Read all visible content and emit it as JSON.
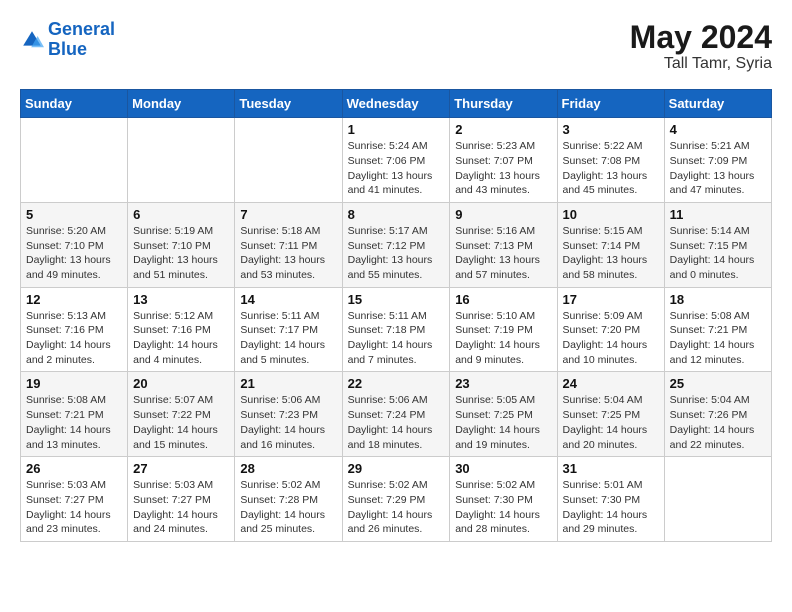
{
  "header": {
    "logo_line1": "General",
    "logo_line2": "Blue",
    "month": "May 2024",
    "location": "Tall Tamr, Syria"
  },
  "weekdays": [
    "Sunday",
    "Monday",
    "Tuesday",
    "Wednesday",
    "Thursday",
    "Friday",
    "Saturday"
  ],
  "weeks": [
    [
      {
        "day": "",
        "info": ""
      },
      {
        "day": "",
        "info": ""
      },
      {
        "day": "",
        "info": ""
      },
      {
        "day": "1",
        "info": "Sunrise: 5:24 AM\nSunset: 7:06 PM\nDaylight: 13 hours\nand 41 minutes."
      },
      {
        "day": "2",
        "info": "Sunrise: 5:23 AM\nSunset: 7:07 PM\nDaylight: 13 hours\nand 43 minutes."
      },
      {
        "day": "3",
        "info": "Sunrise: 5:22 AM\nSunset: 7:08 PM\nDaylight: 13 hours\nand 45 minutes."
      },
      {
        "day": "4",
        "info": "Sunrise: 5:21 AM\nSunset: 7:09 PM\nDaylight: 13 hours\nand 47 minutes."
      }
    ],
    [
      {
        "day": "5",
        "info": "Sunrise: 5:20 AM\nSunset: 7:10 PM\nDaylight: 13 hours\nand 49 minutes."
      },
      {
        "day": "6",
        "info": "Sunrise: 5:19 AM\nSunset: 7:10 PM\nDaylight: 13 hours\nand 51 minutes."
      },
      {
        "day": "7",
        "info": "Sunrise: 5:18 AM\nSunset: 7:11 PM\nDaylight: 13 hours\nand 53 minutes."
      },
      {
        "day": "8",
        "info": "Sunrise: 5:17 AM\nSunset: 7:12 PM\nDaylight: 13 hours\nand 55 minutes."
      },
      {
        "day": "9",
        "info": "Sunrise: 5:16 AM\nSunset: 7:13 PM\nDaylight: 13 hours\nand 57 minutes."
      },
      {
        "day": "10",
        "info": "Sunrise: 5:15 AM\nSunset: 7:14 PM\nDaylight: 13 hours\nand 58 minutes."
      },
      {
        "day": "11",
        "info": "Sunrise: 5:14 AM\nSunset: 7:15 PM\nDaylight: 14 hours\nand 0 minutes."
      }
    ],
    [
      {
        "day": "12",
        "info": "Sunrise: 5:13 AM\nSunset: 7:16 PM\nDaylight: 14 hours\nand 2 minutes."
      },
      {
        "day": "13",
        "info": "Sunrise: 5:12 AM\nSunset: 7:16 PM\nDaylight: 14 hours\nand 4 minutes."
      },
      {
        "day": "14",
        "info": "Sunrise: 5:11 AM\nSunset: 7:17 PM\nDaylight: 14 hours\nand 5 minutes."
      },
      {
        "day": "15",
        "info": "Sunrise: 5:11 AM\nSunset: 7:18 PM\nDaylight: 14 hours\nand 7 minutes."
      },
      {
        "day": "16",
        "info": "Sunrise: 5:10 AM\nSunset: 7:19 PM\nDaylight: 14 hours\nand 9 minutes."
      },
      {
        "day": "17",
        "info": "Sunrise: 5:09 AM\nSunset: 7:20 PM\nDaylight: 14 hours\nand 10 minutes."
      },
      {
        "day": "18",
        "info": "Sunrise: 5:08 AM\nSunset: 7:21 PM\nDaylight: 14 hours\nand 12 minutes."
      }
    ],
    [
      {
        "day": "19",
        "info": "Sunrise: 5:08 AM\nSunset: 7:21 PM\nDaylight: 14 hours\nand 13 minutes."
      },
      {
        "day": "20",
        "info": "Sunrise: 5:07 AM\nSunset: 7:22 PM\nDaylight: 14 hours\nand 15 minutes."
      },
      {
        "day": "21",
        "info": "Sunrise: 5:06 AM\nSunset: 7:23 PM\nDaylight: 14 hours\nand 16 minutes."
      },
      {
        "day": "22",
        "info": "Sunrise: 5:06 AM\nSunset: 7:24 PM\nDaylight: 14 hours\nand 18 minutes."
      },
      {
        "day": "23",
        "info": "Sunrise: 5:05 AM\nSunset: 7:25 PM\nDaylight: 14 hours\nand 19 minutes."
      },
      {
        "day": "24",
        "info": "Sunrise: 5:04 AM\nSunset: 7:25 PM\nDaylight: 14 hours\nand 20 minutes."
      },
      {
        "day": "25",
        "info": "Sunrise: 5:04 AM\nSunset: 7:26 PM\nDaylight: 14 hours\nand 22 minutes."
      }
    ],
    [
      {
        "day": "26",
        "info": "Sunrise: 5:03 AM\nSunset: 7:27 PM\nDaylight: 14 hours\nand 23 minutes."
      },
      {
        "day": "27",
        "info": "Sunrise: 5:03 AM\nSunset: 7:27 PM\nDaylight: 14 hours\nand 24 minutes."
      },
      {
        "day": "28",
        "info": "Sunrise: 5:02 AM\nSunset: 7:28 PM\nDaylight: 14 hours\nand 25 minutes."
      },
      {
        "day": "29",
        "info": "Sunrise: 5:02 AM\nSunset: 7:29 PM\nDaylight: 14 hours\nand 26 minutes."
      },
      {
        "day": "30",
        "info": "Sunrise: 5:02 AM\nSunset: 7:30 PM\nDaylight: 14 hours\nand 28 minutes."
      },
      {
        "day": "31",
        "info": "Sunrise: 5:01 AM\nSunset: 7:30 PM\nDaylight: 14 hours\nand 29 minutes."
      },
      {
        "day": "",
        "info": ""
      }
    ]
  ]
}
